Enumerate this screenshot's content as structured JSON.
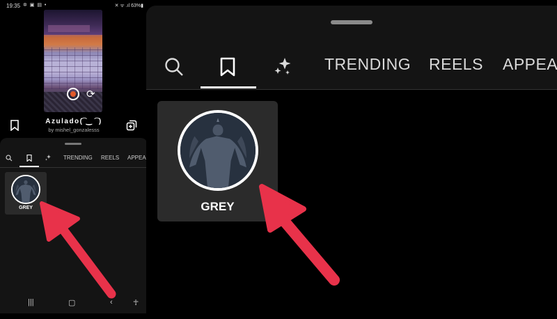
{
  "status_bar": {
    "time": "19:35",
    "icons_text": "✲ ▣ ▤ •",
    "right_text": "✕ ᯤ .ıl 63%▮"
  },
  "effect": {
    "name": "Azulado(͡ ‿ ͡ )",
    "author": "by mishel_gonzalesss"
  },
  "effects_sheet": {
    "tabs": [
      {
        "label": "",
        "icon": "search-icon"
      },
      {
        "label": "",
        "icon": "bookmark-icon",
        "active": true
      },
      {
        "label": "",
        "icon": "sparkles-icon"
      },
      {
        "label": "TRENDING"
      },
      {
        "label": "REELS"
      },
      {
        "label": "APPEAR"
      }
    ],
    "zoom_tabs": [
      {
        "label": "",
        "icon": "search-icon"
      },
      {
        "label": "",
        "icon": "bookmark-icon",
        "active": true
      },
      {
        "label": "",
        "icon": "sparkles-icon"
      },
      {
        "label": "TRENDING"
      },
      {
        "label": "REELS"
      },
      {
        "label": "APPEAR"
      }
    ],
    "saved_items": [
      {
        "label": "GREY"
      }
    ]
  },
  "nav_bar": {
    "icons": [
      "recents-icon",
      "home-icon",
      "back-icon",
      "accessibility-icon"
    ]
  },
  "colors": {
    "annotation_arrow": "#e8324a",
    "sheet_bg": "#141414",
    "card_bg": "#2b2b2b"
  }
}
